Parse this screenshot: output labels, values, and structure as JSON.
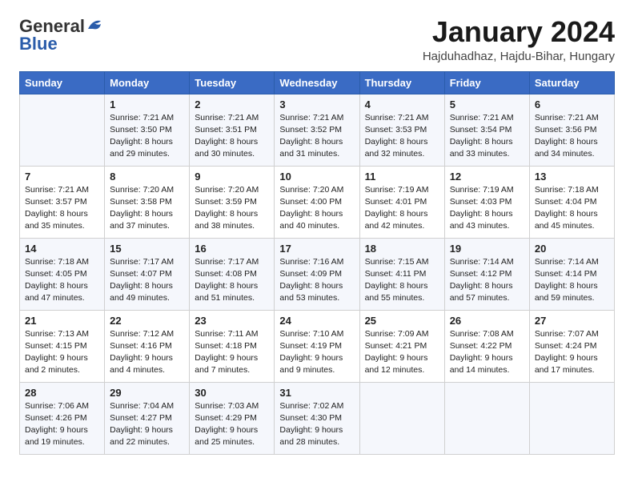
{
  "logo": {
    "line1": "General",
    "line2": "Blue"
  },
  "header": {
    "month": "January 2024",
    "location": "Hajduhadhaz, Hajdu-Bihar, Hungary"
  },
  "weekdays": [
    "Sunday",
    "Monday",
    "Tuesday",
    "Wednesday",
    "Thursday",
    "Friday",
    "Saturday"
  ],
  "weeks": [
    [
      {
        "day": "",
        "sunrise": "",
        "sunset": "",
        "daylight": ""
      },
      {
        "day": "1",
        "sunrise": "Sunrise: 7:21 AM",
        "sunset": "Sunset: 3:50 PM",
        "daylight": "Daylight: 8 hours and 29 minutes."
      },
      {
        "day": "2",
        "sunrise": "Sunrise: 7:21 AM",
        "sunset": "Sunset: 3:51 PM",
        "daylight": "Daylight: 8 hours and 30 minutes."
      },
      {
        "day": "3",
        "sunrise": "Sunrise: 7:21 AM",
        "sunset": "Sunset: 3:52 PM",
        "daylight": "Daylight: 8 hours and 31 minutes."
      },
      {
        "day": "4",
        "sunrise": "Sunrise: 7:21 AM",
        "sunset": "Sunset: 3:53 PM",
        "daylight": "Daylight: 8 hours and 32 minutes."
      },
      {
        "day": "5",
        "sunrise": "Sunrise: 7:21 AM",
        "sunset": "Sunset: 3:54 PM",
        "daylight": "Daylight: 8 hours and 33 minutes."
      },
      {
        "day": "6",
        "sunrise": "Sunrise: 7:21 AM",
        "sunset": "Sunset: 3:56 PM",
        "daylight": "Daylight: 8 hours and 34 minutes."
      }
    ],
    [
      {
        "day": "7",
        "sunrise": "Sunrise: 7:21 AM",
        "sunset": "Sunset: 3:57 PM",
        "daylight": "Daylight: 8 hours and 35 minutes."
      },
      {
        "day": "8",
        "sunrise": "Sunrise: 7:20 AM",
        "sunset": "Sunset: 3:58 PM",
        "daylight": "Daylight: 8 hours and 37 minutes."
      },
      {
        "day": "9",
        "sunrise": "Sunrise: 7:20 AM",
        "sunset": "Sunset: 3:59 PM",
        "daylight": "Daylight: 8 hours and 38 minutes."
      },
      {
        "day": "10",
        "sunrise": "Sunrise: 7:20 AM",
        "sunset": "Sunset: 4:00 PM",
        "daylight": "Daylight: 8 hours and 40 minutes."
      },
      {
        "day": "11",
        "sunrise": "Sunrise: 7:19 AM",
        "sunset": "Sunset: 4:01 PM",
        "daylight": "Daylight: 8 hours and 42 minutes."
      },
      {
        "day": "12",
        "sunrise": "Sunrise: 7:19 AM",
        "sunset": "Sunset: 4:03 PM",
        "daylight": "Daylight: 8 hours and 43 minutes."
      },
      {
        "day": "13",
        "sunrise": "Sunrise: 7:18 AM",
        "sunset": "Sunset: 4:04 PM",
        "daylight": "Daylight: 8 hours and 45 minutes."
      }
    ],
    [
      {
        "day": "14",
        "sunrise": "Sunrise: 7:18 AM",
        "sunset": "Sunset: 4:05 PM",
        "daylight": "Daylight: 8 hours and 47 minutes."
      },
      {
        "day": "15",
        "sunrise": "Sunrise: 7:17 AM",
        "sunset": "Sunset: 4:07 PM",
        "daylight": "Daylight: 8 hours and 49 minutes."
      },
      {
        "day": "16",
        "sunrise": "Sunrise: 7:17 AM",
        "sunset": "Sunset: 4:08 PM",
        "daylight": "Daylight: 8 hours and 51 minutes."
      },
      {
        "day": "17",
        "sunrise": "Sunrise: 7:16 AM",
        "sunset": "Sunset: 4:09 PM",
        "daylight": "Daylight: 8 hours and 53 minutes."
      },
      {
        "day": "18",
        "sunrise": "Sunrise: 7:15 AM",
        "sunset": "Sunset: 4:11 PM",
        "daylight": "Daylight: 8 hours and 55 minutes."
      },
      {
        "day": "19",
        "sunrise": "Sunrise: 7:14 AM",
        "sunset": "Sunset: 4:12 PM",
        "daylight": "Daylight: 8 hours and 57 minutes."
      },
      {
        "day": "20",
        "sunrise": "Sunrise: 7:14 AM",
        "sunset": "Sunset: 4:14 PM",
        "daylight": "Daylight: 8 hours and 59 minutes."
      }
    ],
    [
      {
        "day": "21",
        "sunrise": "Sunrise: 7:13 AM",
        "sunset": "Sunset: 4:15 PM",
        "daylight": "Daylight: 9 hours and 2 minutes."
      },
      {
        "day": "22",
        "sunrise": "Sunrise: 7:12 AM",
        "sunset": "Sunset: 4:16 PM",
        "daylight": "Daylight: 9 hours and 4 minutes."
      },
      {
        "day": "23",
        "sunrise": "Sunrise: 7:11 AM",
        "sunset": "Sunset: 4:18 PM",
        "daylight": "Daylight: 9 hours and 7 minutes."
      },
      {
        "day": "24",
        "sunrise": "Sunrise: 7:10 AM",
        "sunset": "Sunset: 4:19 PM",
        "daylight": "Daylight: 9 hours and 9 minutes."
      },
      {
        "day": "25",
        "sunrise": "Sunrise: 7:09 AM",
        "sunset": "Sunset: 4:21 PM",
        "daylight": "Daylight: 9 hours and 12 minutes."
      },
      {
        "day": "26",
        "sunrise": "Sunrise: 7:08 AM",
        "sunset": "Sunset: 4:22 PM",
        "daylight": "Daylight: 9 hours and 14 minutes."
      },
      {
        "day": "27",
        "sunrise": "Sunrise: 7:07 AM",
        "sunset": "Sunset: 4:24 PM",
        "daylight": "Daylight: 9 hours and 17 minutes."
      }
    ],
    [
      {
        "day": "28",
        "sunrise": "Sunrise: 7:06 AM",
        "sunset": "Sunset: 4:26 PM",
        "daylight": "Daylight: 9 hours and 19 minutes."
      },
      {
        "day": "29",
        "sunrise": "Sunrise: 7:04 AM",
        "sunset": "Sunset: 4:27 PM",
        "daylight": "Daylight: 9 hours and 22 minutes."
      },
      {
        "day": "30",
        "sunrise": "Sunrise: 7:03 AM",
        "sunset": "Sunset: 4:29 PM",
        "daylight": "Daylight: 9 hours and 25 minutes."
      },
      {
        "day": "31",
        "sunrise": "Sunrise: 7:02 AM",
        "sunset": "Sunset: 4:30 PM",
        "daylight": "Daylight: 9 hours and 28 minutes."
      },
      {
        "day": "",
        "sunrise": "",
        "sunset": "",
        "daylight": ""
      },
      {
        "day": "",
        "sunrise": "",
        "sunset": "",
        "daylight": ""
      },
      {
        "day": "",
        "sunrise": "",
        "sunset": "",
        "daylight": ""
      }
    ]
  ]
}
